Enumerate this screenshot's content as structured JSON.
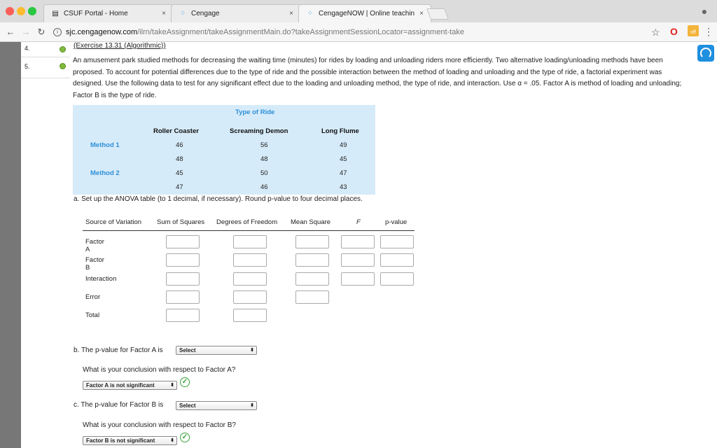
{
  "tabs": [
    {
      "title": "CSUF Portal - Home",
      "icon": "page-icon",
      "close": "×"
    },
    {
      "title": "Cengage",
      "icon": "cengage-icon",
      "close": "×"
    },
    {
      "title": "CengageNOW | Online teachin",
      "icon": "cengage-icon",
      "close": "×"
    }
  ],
  "browser": {
    "host": "sjc.cengagenow.com",
    "path": "/ilrn/takeAssignment/takeAssignmentMain.do?takeAssignmentSessionLocator=assignment-take",
    "info_glyph": "i",
    "ext_off_label": "off"
  },
  "questions": [
    {
      "number": "4."
    },
    {
      "number": "5."
    }
  ],
  "exercise_link": "(Exercise 13.31 (Algorithmic))",
  "problem": {
    "text": "An amusement park studied methods for decreasing the waiting time (minutes) for rides by loading and unloading riders more efficiently. Two alternative loading/unloading methods have been proposed. To account for potential differences due to the type of ride and the possible interaction between the method of loading and unloading and the type of ride, a factorial experiment was designed. Use the following data to test for any significant effect due to the loading and unloading method, the type of ride, and interaction. Use α = .05. Factor A is method of loading and unloading; Factor B is the type of ride."
  },
  "data_table": {
    "type_header": "Type of Ride",
    "columns": [
      "Roller Coaster",
      "Screaming Demon",
      "Long Flume"
    ],
    "method1_label": "Method 1",
    "method2_label": "Method 2",
    "rows": [
      [
        "46",
        "56",
        "49"
      ],
      [
        "48",
        "48",
        "45"
      ],
      [
        "45",
        "50",
        "47"
      ],
      [
        "47",
        "46",
        "43"
      ]
    ]
  },
  "part_a": "a. Set up the ANOVA table (to 1 decimal, if necessary). Round p-value to four decimal places.",
  "anova": {
    "headers": [
      "Source of Variation",
      "Sum of Squares",
      "Degrees of Freedom",
      "Mean Square",
      "F",
      "p-value"
    ],
    "sources": [
      "Factor A",
      "Factor B",
      "Interaction",
      "Error",
      "Total"
    ]
  },
  "part_b": {
    "question": "b. The p-value for Factor A is",
    "select": "Select",
    "conclusion_q": "What is your conclusion with respect to Factor A?",
    "conclusion": "Factor A is not significant"
  },
  "part_c": {
    "question": "c. The p-value for Factor B is",
    "select": "Select",
    "conclusion_q": "What is your conclusion with respect to Factor B?",
    "conclusion": "Factor B is not significant"
  },
  "colors": {
    "accent": "#2d8fd8",
    "table_bg": "#d6ebf9",
    "check": "#3aa23a"
  }
}
